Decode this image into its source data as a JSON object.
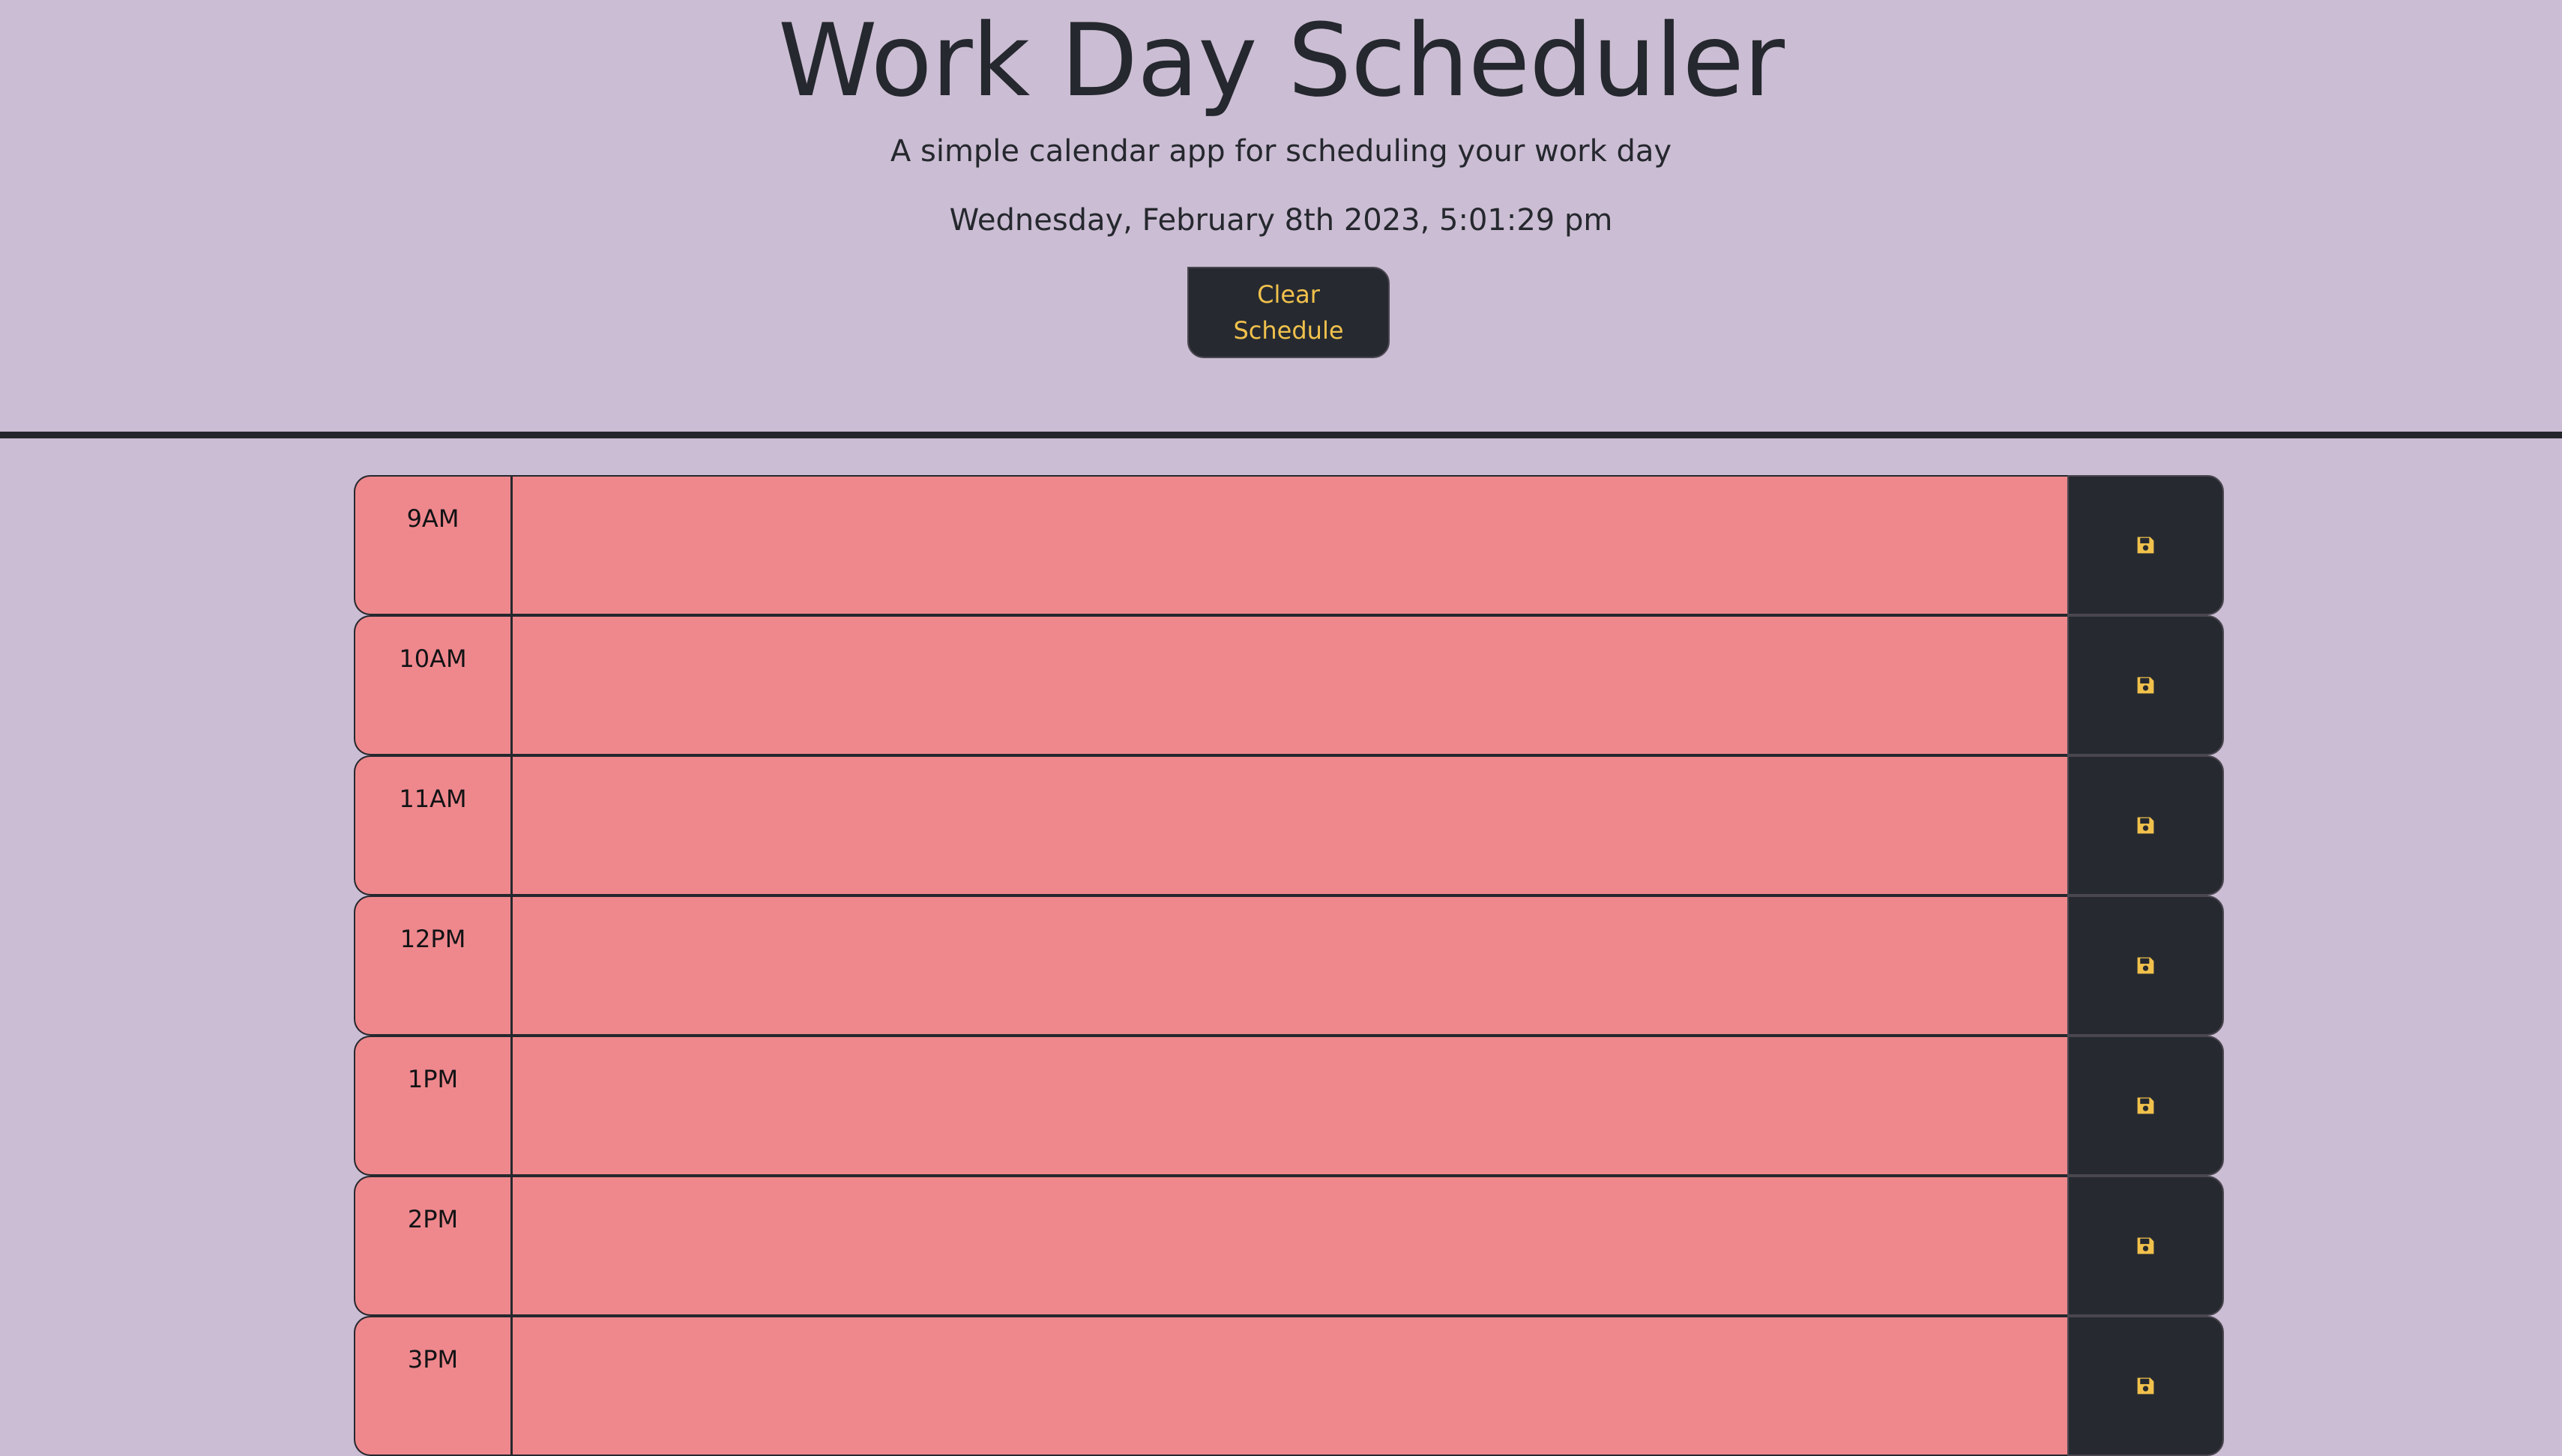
{
  "header": {
    "title": "Work Day Scheduler",
    "subtitle": "A simple calendar app for scheduling your work day",
    "current_datetime": "Wednesday, February 8th 2023, 5:01:29 pm",
    "clear_button_label": "Clear Schedule"
  },
  "time_blocks": [
    {
      "hour": "9AM",
      "task": "",
      "save_icon": "floppy-disk-icon"
    },
    {
      "hour": "10AM",
      "task": "",
      "save_icon": "floppy-disk-icon"
    },
    {
      "hour": "11AM",
      "task": "",
      "save_icon": "floppy-disk-icon"
    },
    {
      "hour": "12PM",
      "task": "",
      "save_icon": "floppy-disk-icon"
    },
    {
      "hour": "1PM",
      "task": "",
      "save_icon": "floppy-disk-icon"
    },
    {
      "hour": "2PM",
      "task": "",
      "save_icon": "floppy-disk-icon"
    },
    {
      "hour": "3PM",
      "task": "",
      "save_icon": "floppy-disk-icon"
    }
  ],
  "colors": {
    "background": "#cbbdd3",
    "past_block": "#ef888c",
    "button_dark": "#262a30",
    "button_accent": "#f1c14c",
    "divider": "#24262b"
  }
}
